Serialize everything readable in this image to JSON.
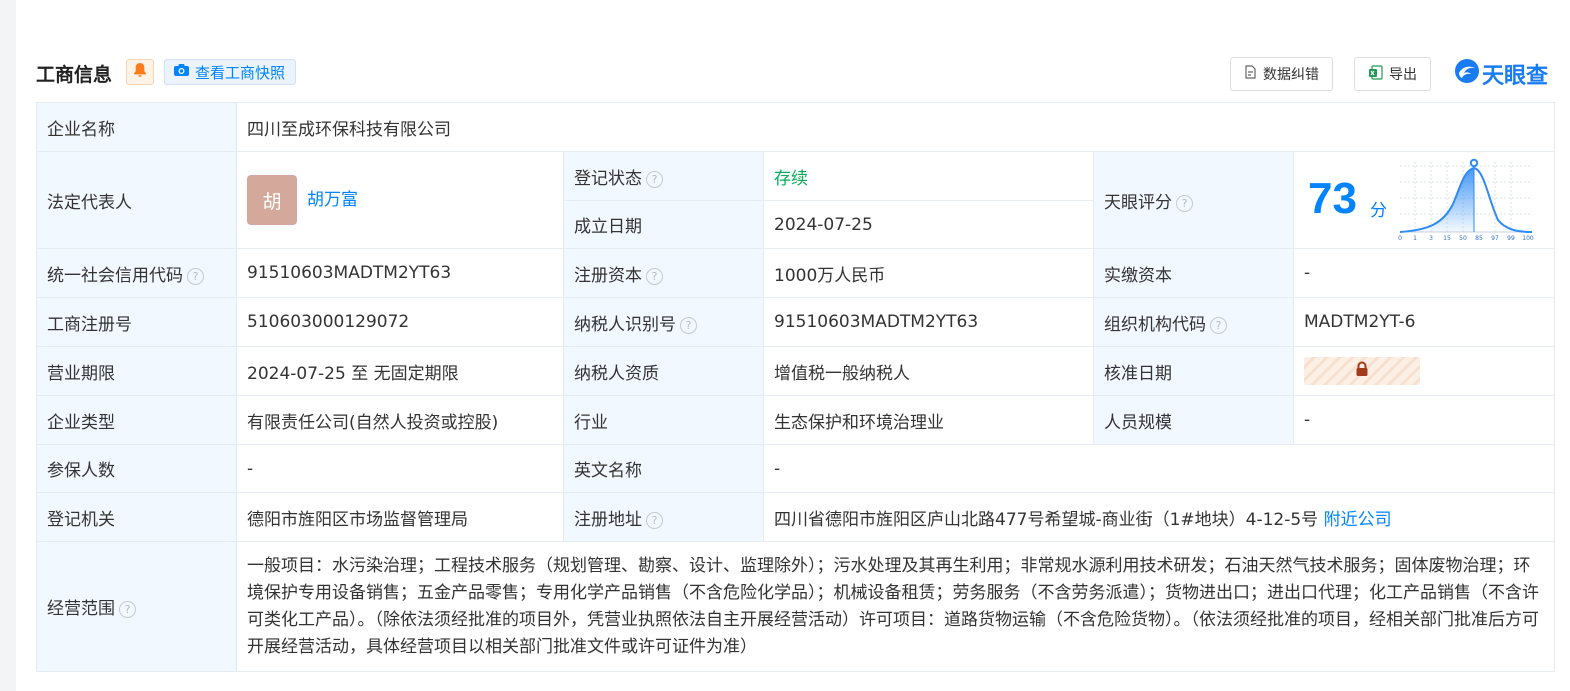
{
  "header": {
    "title": "工商信息",
    "snapshot_label": "查看工商快照",
    "fix_label": "数据纠错",
    "export_label": "导出",
    "brand_name": "天眼查"
  },
  "info": {
    "company_name_label": "企业名称",
    "company_name": "四川至成环保科技有限公司",
    "legal_rep_label": "法定代表人",
    "legal_rep_avatar": "胡",
    "legal_rep_name": "胡万富",
    "reg_status_label": "登记状态",
    "reg_status": "存续",
    "est_date_label": "成立日期",
    "est_date": "2024-07-25",
    "score_label": "天眼评分",
    "score_value": "73",
    "score_unit": "分",
    "score_axis": [
      "0",
      "1",
      "3",
      "15",
      "50",
      "85",
      "97",
      "99",
      "100"
    ],
    "credit_code_label": "统一社会信用代码",
    "credit_code": "91510603MADTM2YT63",
    "reg_capital_label": "注册资本",
    "reg_capital": "1000万人民币",
    "paid_capital_label": "实缴资本",
    "paid_capital": "-",
    "biz_reg_no_label": "工商注册号",
    "biz_reg_no": "510603000129072",
    "taxpayer_id_label": "纳税人识别号",
    "taxpayer_id": "91510603MADTM2YT63",
    "org_code_label": "组织机构代码",
    "org_code": "MADTM2YT-6",
    "biz_term_label": "营业期限",
    "biz_term": "2024-07-25 至 无固定期限",
    "taxpayer_qual_label": "纳税人资质",
    "taxpayer_qual": "增值税一般纳税人",
    "approval_date_label": "核准日期",
    "company_type_label": "企业类型",
    "company_type": "有限责任公司(自然人投资或控股)",
    "industry_label": "行业",
    "industry": "生态保护和环境治理业",
    "staff_size_label": "人员规模",
    "staff_size": "-",
    "insured_label": "参保人数",
    "insured": "-",
    "english_name_label": "英文名称",
    "english_name": "-",
    "reg_authority_label": "登记机关",
    "reg_authority": "德阳市旌阳区市场监督管理局",
    "reg_address_label": "注册地址",
    "reg_address": "四川省德阳市旌阳区庐山北路477号希望城-商业街（1#地块）4-12-5号",
    "nearby_label": "附近公司",
    "scope_label": "经营范围",
    "scope": "一般项目：水污染治理；工程技术服务（规划管理、勘察、设计、监理除外）；污水处理及其再生利用；非常规水源利用技术研发；石油天然气技术服务；固体废物治理；环境保护专用设备销售；五金产品零售；专用化学产品销售（不含危险化学品）；机械设备租赁；劳务服务（不含劳务派遣）；货物进出口；进出口代理；化工产品销售（不含许可类化工产品）。（除依法须经批准的项目外，凭营业执照依法自主开展经营活动）许可项目：道路货物运输（不含危险货物）。（依法须经批准的项目，经相关部门批准后方可开展经营活动，具体经营项目以相关部门批准文件或许可证件为准）"
  },
  "colors": {
    "accent": "#0084ff",
    "status_green": "#0bab5c",
    "label_bg": "#f2f8ff",
    "border": "#e7ecf3"
  }
}
